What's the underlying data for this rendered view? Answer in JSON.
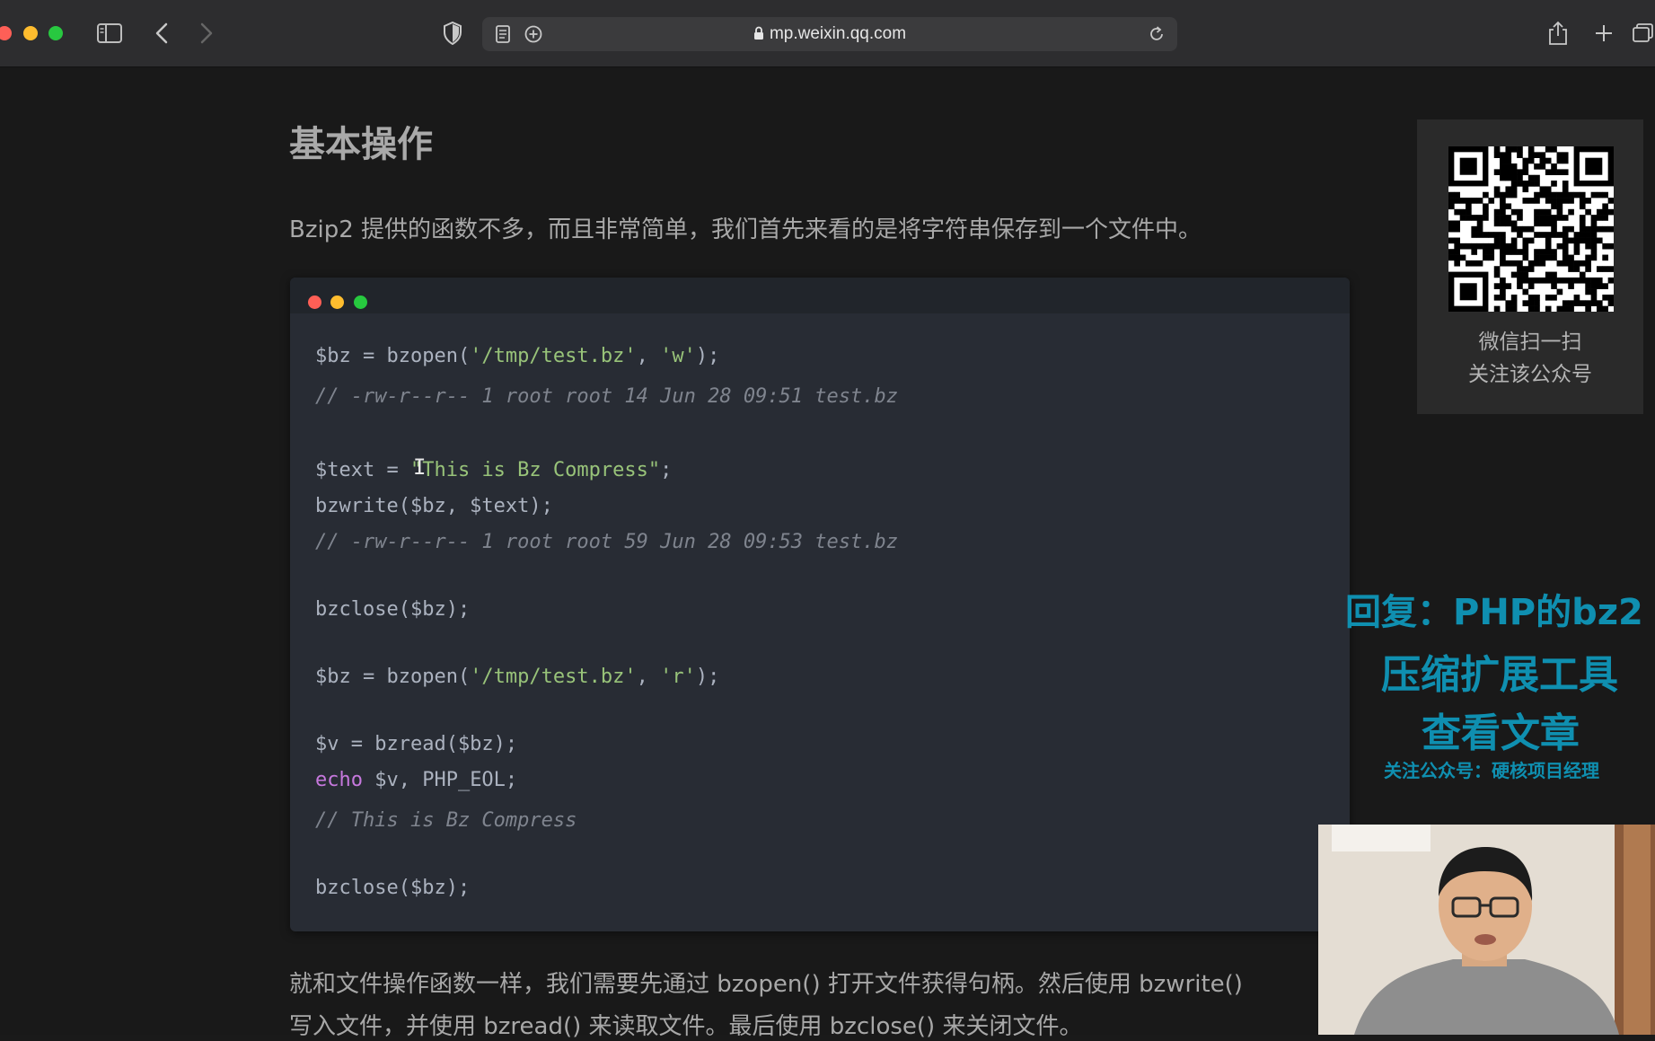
{
  "browser": {
    "url": "mp.weixin.qq.com"
  },
  "article": {
    "heading": "基本操作",
    "intro": "Bzip2 提供的函数不多，而且非常简单，我们首先来看的是将字符串保存到一个文件中。",
    "code": {
      "l1_var": "$bz = bzopen(",
      "l1_s1": "'/tmp/test.bz'",
      "l1_mid": ", ",
      "l1_s2": "'w'",
      "l1_end": ");",
      "l2": "// -rw-r--r-- 1 root root 14 Jun 28 09:51 test.bz",
      "l3_var": "$text = ",
      "l3_s": "\"This is Bz Compress\"",
      "l3_end": ";",
      "l4": "bzwrite($bz, $text);",
      "l5": "// -rw-r--r-- 1 root root 59 Jun 28 09:53 test.bz",
      "l6": "bzclose($bz);",
      "l7_var": "$bz = bzopen(",
      "l7_s1": "'/tmp/test.bz'",
      "l7_mid": ", ",
      "l7_s2": "'r'",
      "l7_end": ");",
      "l8": "$v = bzread($bz);",
      "l9_kw": "echo",
      "l9_rest": " $v, PHP_EOL;",
      "l10": "// This is Bz Compress",
      "l11": "bzclose($bz);"
    },
    "outro_line1": "就和文件操作函数一样，我们需要先通过 bzopen() 打开文件获得句柄。然后使用 bzwrite()",
    "outro_line2": "写入文件，并使用 bzread() 来读取文件。最后使用 bzclose() 来关闭文件。"
  },
  "sidebar": {
    "qr_caption_line1": "微信扫一扫",
    "qr_caption_line2": "关注该公众号"
  },
  "overlay": {
    "line1": "回复：PHP的bz2",
    "line2": "压缩扩展工具",
    "line3": "查看文章",
    "line4": "关注公众号：硬核项目经理",
    "color": "#0f8fb0"
  }
}
